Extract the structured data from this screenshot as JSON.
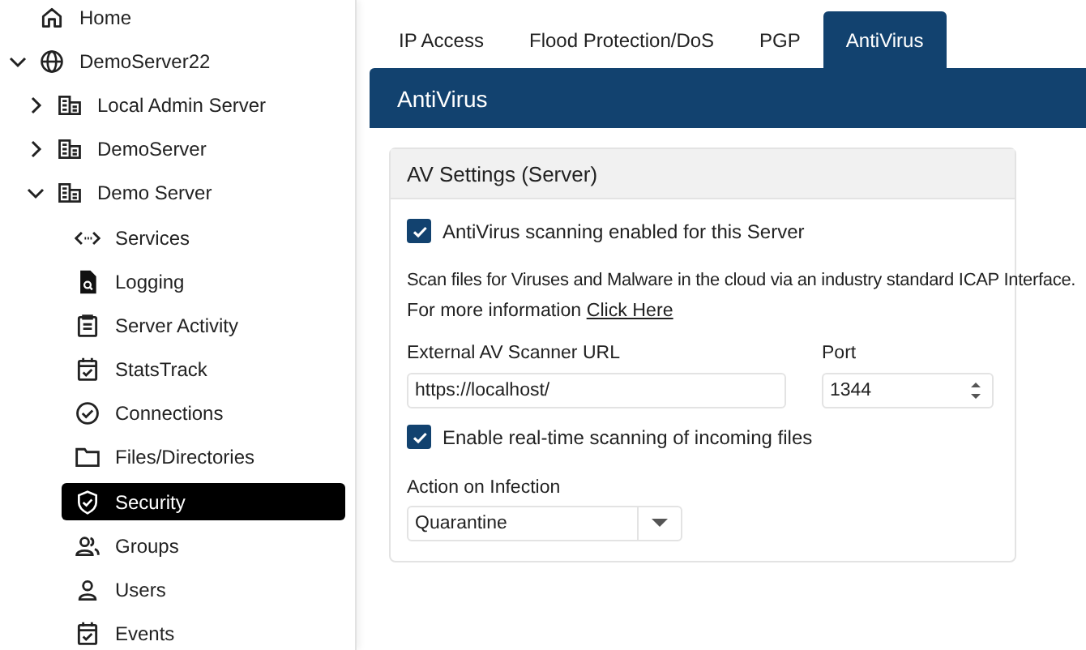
{
  "sidebar": {
    "tree": [
      {
        "label": "Home",
        "kind": "home",
        "selected": false
      },
      {
        "label": "DemoServer22",
        "kind": "globe",
        "selected": false,
        "expanded": true,
        "children": [
          {
            "label": "Local Admin Server",
            "kind": "building",
            "selected": false,
            "expanded": false
          },
          {
            "label": "DemoServer",
            "kind": "building",
            "selected": false,
            "expanded": false
          },
          {
            "label": "Demo Server",
            "kind": "building",
            "selected": false,
            "expanded": true,
            "children": [
              {
                "label": "Services",
                "kind": "code",
                "selected": false
              },
              {
                "label": "Logging",
                "kind": "filesearch",
                "selected": false
              },
              {
                "label": "Server Activity",
                "kind": "clipboard",
                "selected": false
              },
              {
                "label": "StatsTrack",
                "kind": "calendar",
                "selected": false
              },
              {
                "label": "Connections",
                "kind": "checkcircle",
                "selected": false
              },
              {
                "label": "Files/Directories",
                "kind": "folder",
                "selected": false
              },
              {
                "label": "Security",
                "kind": "shield",
                "selected": true
              },
              {
                "label": "Groups",
                "kind": "users",
                "selected": false
              },
              {
                "label": "Users",
                "kind": "user",
                "selected": false
              },
              {
                "label": "Events",
                "kind": "calendar",
                "selected": false
              }
            ]
          }
        ]
      }
    ]
  },
  "tabs": [
    {
      "label": "IP Access",
      "selected": false
    },
    {
      "label": "Flood Protection/DoS",
      "selected": false
    },
    {
      "label": "PGP",
      "selected": false
    },
    {
      "label": "AntiVirus",
      "selected": true
    }
  ],
  "panel": {
    "title": "AntiVirus",
    "card": {
      "title": "AV Settings (Server)",
      "enable_checkbox": {
        "label": "AntiVirus scanning enabled for this Server",
        "checked": true
      },
      "description": "Scan files for Viruses and Malware in the cloud via an industry standard ICAP Interface.",
      "info_text": "For more information",
      "info_link": "Click Here",
      "url_field": {
        "label": "External AV Scanner URL",
        "value": "https://localhost/"
      },
      "port_field": {
        "label": "Port",
        "value": "1344"
      },
      "realtime_checkbox": {
        "label": "Enable real-time scanning of incoming files",
        "checked": true
      },
      "action_select": {
        "label": "Action on Infection",
        "value": "Quarantine"
      }
    }
  }
}
